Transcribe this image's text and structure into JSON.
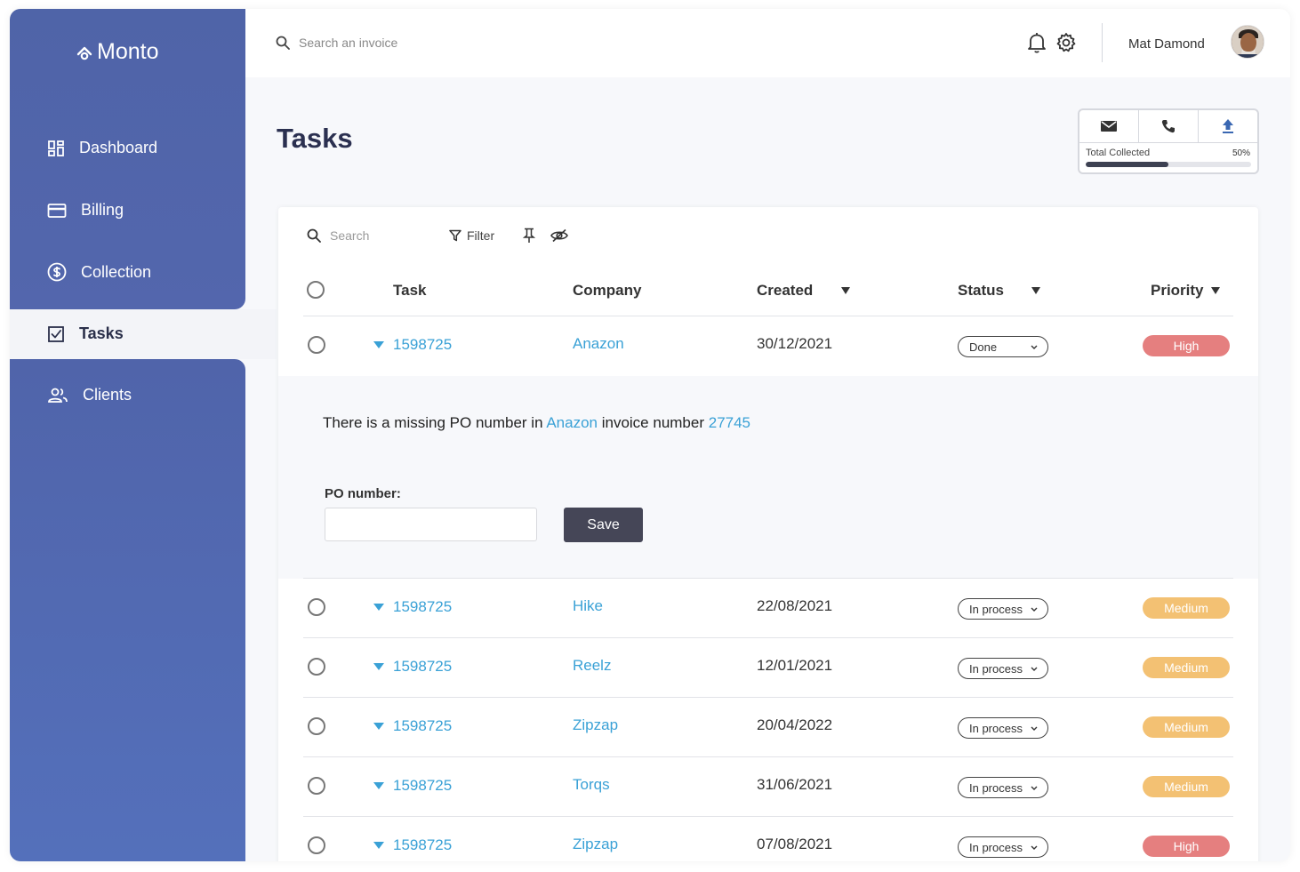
{
  "app": {
    "brand": "Monto"
  },
  "sidebar": {
    "items": [
      {
        "label": "Dashboard",
        "icon": "dashboard-icon"
      },
      {
        "label": "Billing",
        "icon": "card-icon"
      },
      {
        "label": "Collection",
        "icon": "dollar-icon"
      },
      {
        "label": "Tasks",
        "icon": "checkbox-icon",
        "active": true
      },
      {
        "label": "Clients",
        "icon": "users-icon"
      }
    ]
  },
  "header": {
    "search_placeholder": "Search an invoice",
    "user_name": "Mat Damond"
  },
  "page": {
    "title": "Tasks"
  },
  "widget": {
    "label": "Total Collected",
    "percent_text": "50%",
    "progress": 0.5,
    "buttons": [
      "mail-icon",
      "phone-icon",
      "upload-icon"
    ]
  },
  "toolbar": {
    "search_placeholder": "Search",
    "filter_label": "Filter"
  },
  "table": {
    "headers": {
      "task": "Task",
      "company": "Company",
      "created": "Created",
      "status": "Status",
      "priority": "Priority"
    },
    "rows": [
      {
        "task": "1598725",
        "company": "Anazon",
        "created": "30/12/2021",
        "status": "Done",
        "priority": "High"
      },
      {
        "task": "1598725",
        "company": "Hike",
        "created": "22/08/2021",
        "status": "In process",
        "priority": "Medium"
      },
      {
        "task": "1598725",
        "company": "Reelz",
        "created": "12/01/2021",
        "status": "In process",
        "priority": "Medium"
      },
      {
        "task": "1598725",
        "company": "Zipzap",
        "created": "20/04/2022",
        "status": "In process",
        "priority": "Medium"
      },
      {
        "task": "1598725",
        "company": "Torqs",
        "created": "31/06/2021",
        "status": "In process",
        "priority": "Medium"
      },
      {
        "task": "1598725",
        "company": "Zipzap",
        "created": "07/08/2021",
        "status": "In process",
        "priority": "High"
      }
    ]
  },
  "expanded": {
    "msg_prefix": "There is a missing PO number in ",
    "msg_company": "Anazon",
    "msg_middle": " invoice number ",
    "msg_invoice": "27745",
    "po_label": "PO number:",
    "po_value": "",
    "save_label": "Save"
  },
  "colors": {
    "accent": "#3aa1d6",
    "sidebar": "#5066ab",
    "high": "#e57f7f",
    "medium": "#f3c173",
    "save": "#454657"
  }
}
